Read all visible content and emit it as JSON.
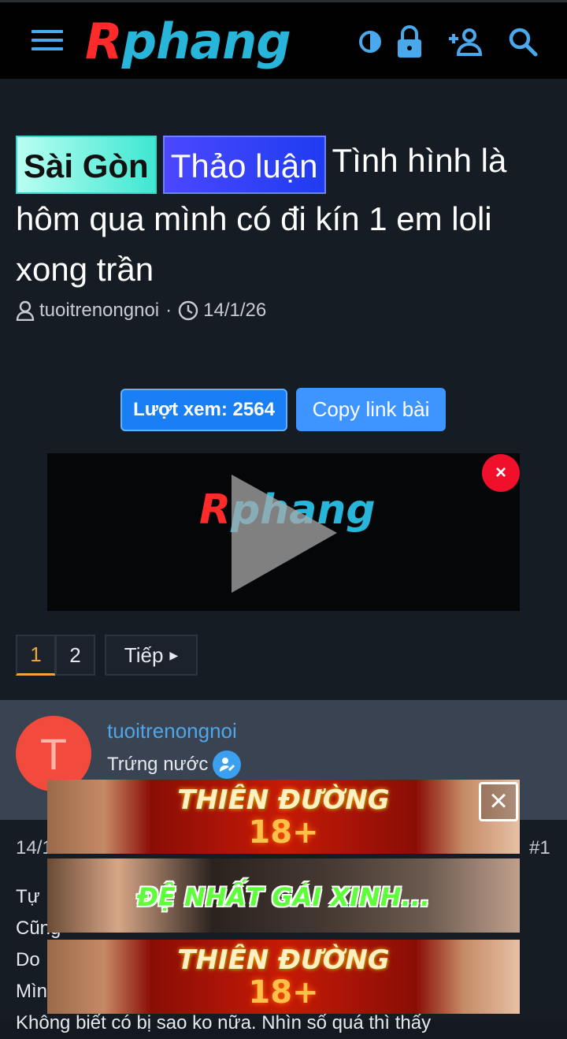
{
  "header": {
    "logo_first": "R",
    "logo_rest": "phang",
    "icons": [
      "menu-icon",
      "contrast-icon",
      "lock-icon",
      "add-user-icon",
      "search-icon"
    ],
    "accent_color": "#4aa8ec"
  },
  "thread": {
    "tags": [
      "Sài Gòn",
      "Thảo luận"
    ],
    "title": "Tình hình là hôm qua mình có đi kín 1 em loli xong trần",
    "author": "tuoitrenongnoi",
    "date": "14/1/26",
    "views_label": "Lượt xem: 2564",
    "copy_label": "Copy link bài"
  },
  "video": {
    "logo_first": "R",
    "logo_rest": "phang",
    "close": "×"
  },
  "pagination": {
    "pages": [
      "1",
      "2"
    ],
    "current": "1",
    "next_label": "Tiếp"
  },
  "post": {
    "avatar_letter": "T",
    "username": "tuoitrenongnoi",
    "user_title": "Trứng nước",
    "date_partial": "14/1/26",
    "number": "#1",
    "lines": [
      "Tự",
      "Cũng",
      "Do",
      "Mìn",
      "Không biết có bị sao ko nữa. Nhìn số quá thì thấy"
    ]
  },
  "ads": {
    "banner1_text": "THIÊN ĐƯỜNG",
    "banner1_num": "18+",
    "banner2_text": "ĐỆ NHẤT GÁI XINH...",
    "banner3_text": "THIÊN ĐƯỜNG",
    "banner3_num": "18+",
    "close": "×"
  }
}
